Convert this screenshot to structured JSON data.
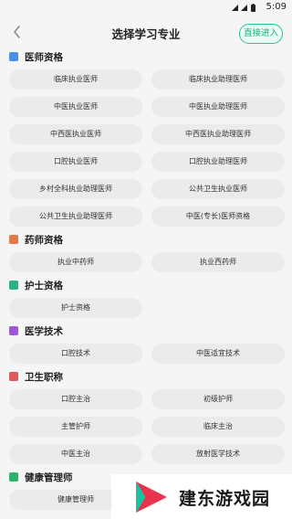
{
  "status_bar": {
    "time": "5:09"
  },
  "header": {
    "title": "选择学习专业",
    "skip_label": "直接进入"
  },
  "sections": [
    {
      "title": "医师资格",
      "icon": "doctor-icon",
      "color": "#4a8ee6",
      "items": [
        "临床执业医师",
        "临床执业助理医师",
        "中医执业医师",
        "中医执业助理医师",
        "中西医执业医师",
        "中西医执业助理医师",
        "口腔执业医师",
        "口腔执业助理医师",
        "乡村全科执业助理医师",
        "公共卫生执业医师",
        "公共卫生执业助理医师",
        "中医(专长)医师资格"
      ]
    },
    {
      "title": "药师资格",
      "icon": "pharmacist-icon",
      "color": "#e07a4a",
      "items": [
        "执业中药师",
        "执业西药师"
      ]
    },
    {
      "title": "护士资格",
      "icon": "nurse-icon",
      "color": "#2ab38a",
      "items": [
        "护士资格"
      ]
    },
    {
      "title": "医学技术",
      "icon": "medtech-icon",
      "color": "#9b59d6",
      "items": [
        "口腔技术",
        "中医适宜技术"
      ]
    },
    {
      "title": "卫生职称",
      "icon": "title-icon",
      "color": "#e05a5a",
      "items": [
        "口腔主治",
        "初级护师",
        "主管护师",
        "临床主治",
        "中医主治",
        "放射医学技术"
      ]
    },
    {
      "title": "健康管理师",
      "icon": "health-icon",
      "color": "#2ab36a",
      "items": [
        "健康管理师"
      ]
    }
  ],
  "watermark": {
    "text": "建东游戏园"
  }
}
